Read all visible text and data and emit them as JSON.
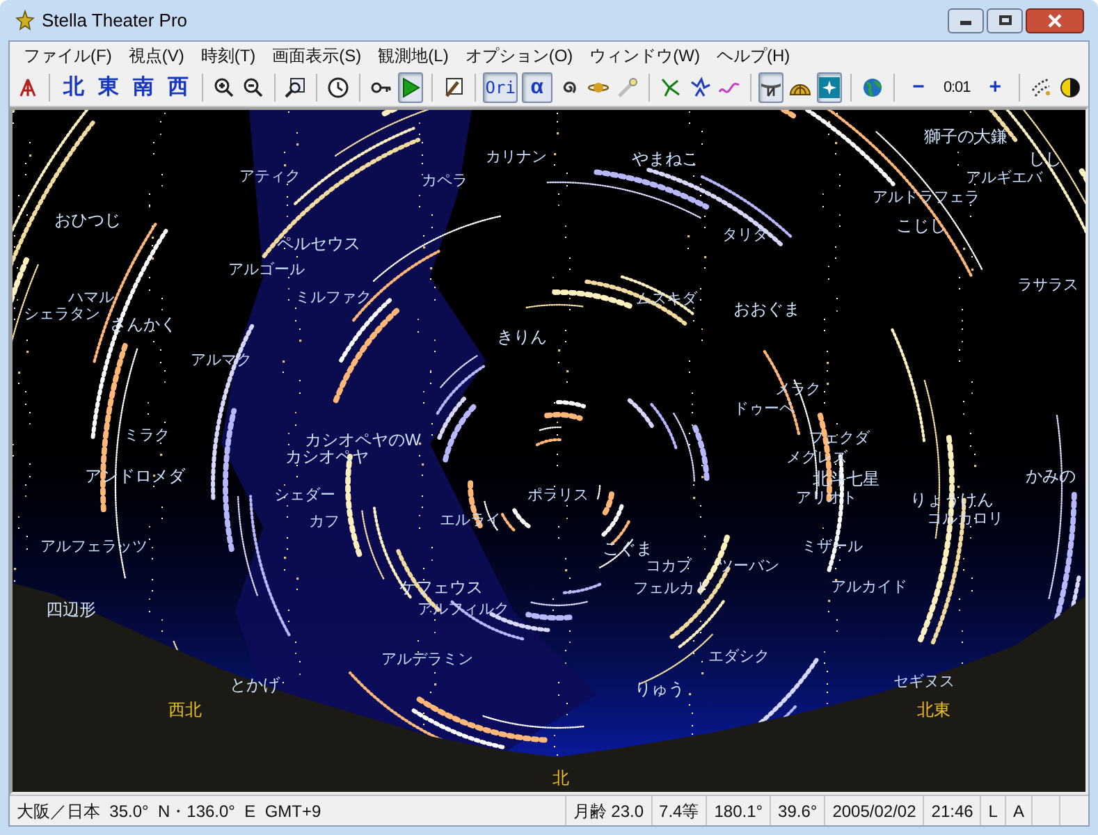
{
  "window": {
    "title": "Stella Theater Pro"
  },
  "menu": [
    {
      "label": "ファイル(F)"
    },
    {
      "label": "視点(V)"
    },
    {
      "label": "時刻(T)"
    },
    {
      "label": "画面表示(S)"
    },
    {
      "label": "観測地(L)"
    },
    {
      "label": "オプション(O)"
    },
    {
      "label": "ウィンドウ(W)"
    },
    {
      "label": "ヘルプ(H)"
    }
  ],
  "toolbar": [
    {
      "kind": "icon",
      "selected": false
    },
    {
      "kind": "sep"
    },
    {
      "kind": "text",
      "label": "北",
      "selected": false
    },
    {
      "kind": "text",
      "label": "東",
      "selected": false
    },
    {
      "kind": "text",
      "label": "南",
      "selected": false
    },
    {
      "kind": "text",
      "label": "西",
      "selected": false
    },
    {
      "kind": "sep"
    },
    {
      "kind": "icon",
      "selected": false
    },
    {
      "kind": "icon",
      "selected": false
    },
    {
      "kind": "sep"
    },
    {
      "kind": "icon",
      "selected": false
    },
    {
      "kind": "sep"
    },
    {
      "kind": "icon",
      "selected": false
    },
    {
      "kind": "sep"
    },
    {
      "kind": "icon",
      "selected": false
    },
    {
      "kind": "icon",
      "selected": true
    },
    {
      "kind": "sep"
    },
    {
      "kind": "icon",
      "selected": false
    },
    {
      "kind": "sep"
    },
    {
      "kind": "text",
      "label": "Ori",
      "selected": true
    },
    {
      "kind": "text",
      "label": "α",
      "selected": true
    },
    {
      "kind": "icon",
      "selected": false
    },
    {
      "kind": "icon",
      "selected": false
    },
    {
      "kind": "icon",
      "selected": false
    },
    {
      "kind": "sep"
    },
    {
      "kind": "icon",
      "selected": false
    },
    {
      "kind": "icon",
      "selected": false
    },
    {
      "kind": "icon",
      "selected": false
    },
    {
      "kind": "sep"
    },
    {
      "kind": "icon",
      "selected": true
    },
    {
      "kind": "icon",
      "selected": false
    },
    {
      "kind": "icon",
      "selected": true
    },
    {
      "kind": "sep"
    },
    {
      "kind": "icon",
      "selected": false
    },
    {
      "kind": "sep"
    },
    {
      "kind": "text",
      "label": "−",
      "selected": false
    },
    {
      "kind": "reading",
      "label": "0:01"
    },
    {
      "kind": "text",
      "label": "+",
      "selected": false
    },
    {
      "kind": "sep"
    },
    {
      "kind": "icon",
      "selected": false
    },
    {
      "kind": "icon",
      "selected": false
    }
  ],
  "sky": {
    "labels": [
      {
        "text": "獅子の大鎌",
        "kind": "constellation"
      },
      {
        "text": "カリナン",
        "kind": "star"
      },
      {
        "text": "やまねこ",
        "kind": "constellation"
      },
      {
        "text": "しし",
        "kind": "constellation"
      },
      {
        "text": "アティク",
        "kind": "star"
      },
      {
        "text": "カペラ",
        "kind": "star"
      },
      {
        "text": "アルギエバ",
        "kind": "star"
      },
      {
        "text": "アルドラフェラ",
        "kind": "star"
      },
      {
        "text": "おひつじ",
        "kind": "constellation"
      },
      {
        "text": "こじし",
        "kind": "constellation"
      },
      {
        "text": "タリタ",
        "kind": "star"
      },
      {
        "text": "ペルセウス",
        "kind": "constellation"
      },
      {
        "text": "アルゴール",
        "kind": "star"
      },
      {
        "text": "ラサラス",
        "kind": "star"
      },
      {
        "text": "ハマル",
        "kind": "star"
      },
      {
        "text": "ミルファク",
        "kind": "star"
      },
      {
        "text": "ムスキダ",
        "kind": "star"
      },
      {
        "text": "おおぐま",
        "kind": "constellation"
      },
      {
        "text": "シェラタン",
        "kind": "star"
      },
      {
        "text": "さんかく",
        "kind": "constellation"
      },
      {
        "text": "きりん",
        "kind": "constellation"
      },
      {
        "text": "アルマク",
        "kind": "star"
      },
      {
        "text": "メラク",
        "kind": "star"
      },
      {
        "text": "ドゥーベ",
        "kind": "star"
      },
      {
        "text": "ミラク",
        "kind": "star"
      },
      {
        "text": "カシオペヤのW",
        "kind": "constellation"
      },
      {
        "text": "フェクダ",
        "kind": "star"
      },
      {
        "text": "カシオペヤ",
        "kind": "constellation"
      },
      {
        "text": "メグレズ",
        "kind": "star"
      },
      {
        "text": "アンドロメダ",
        "kind": "constellation"
      },
      {
        "text": "北斗七星",
        "kind": "constellation"
      },
      {
        "text": "かみの",
        "kind": "constellation"
      },
      {
        "text": "シェダー",
        "kind": "star"
      },
      {
        "text": "ポラリス",
        "kind": "star"
      },
      {
        "text": "アリオト",
        "kind": "star"
      },
      {
        "text": "りょうけん",
        "kind": "constellation"
      },
      {
        "text": "カフ",
        "kind": "star"
      },
      {
        "text": "エルライ",
        "kind": "star"
      },
      {
        "text": "コルカロリ",
        "kind": "star"
      },
      {
        "text": "アルフェラッツ",
        "kind": "star"
      },
      {
        "text": "こぐま",
        "kind": "constellation"
      },
      {
        "text": "ミザール",
        "kind": "star"
      },
      {
        "text": "コカブ",
        "kind": "star"
      },
      {
        "text": "ツーバン",
        "kind": "star"
      },
      {
        "text": "ケフェウス",
        "kind": "constellation"
      },
      {
        "text": "フェルカド",
        "kind": "star"
      },
      {
        "text": "アルカイド",
        "kind": "star"
      },
      {
        "text": "四辺形",
        "kind": "constellation"
      },
      {
        "text": "アルフィルク",
        "kind": "star"
      },
      {
        "text": "アルデラミン",
        "kind": "star"
      },
      {
        "text": "エダシク",
        "kind": "star"
      },
      {
        "text": "とかげ",
        "kind": "constellation"
      },
      {
        "text": "りゅう",
        "kind": "constellation"
      },
      {
        "text": "セギヌス",
        "kind": "star"
      },
      {
        "text": "西北",
        "kind": "direction"
      },
      {
        "text": "北東",
        "kind": "direction"
      },
      {
        "text": "北",
        "kind": "direction"
      }
    ]
  },
  "status_bar": [
    {
      "text": "大阪／日本  35.0°  N・136.0°  E  GMT+9"
    },
    {
      "text": "月齢 23.0"
    },
    {
      "text": "7.4等"
    },
    {
      "text": "180.1°"
    },
    {
      "text": "39.6°"
    },
    {
      "text": "2005/02/02"
    },
    {
      "text": "21:46"
    },
    {
      "text": "L"
    },
    {
      "text": "A"
    }
  ]
}
